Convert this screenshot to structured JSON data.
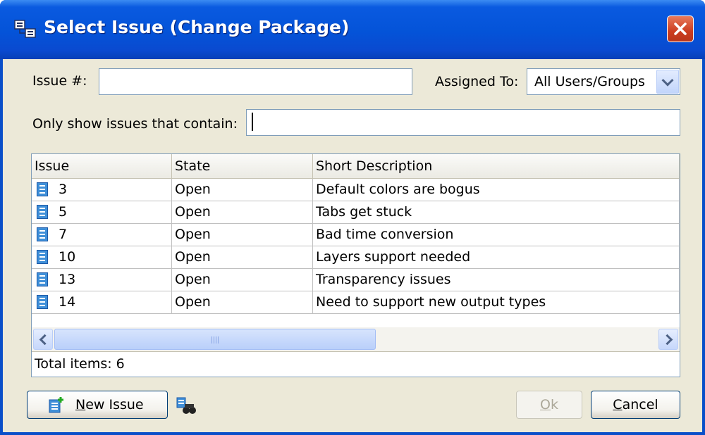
{
  "window": {
    "title": "Select Issue (Change Package)"
  },
  "form": {
    "issue_label": "Issue #:",
    "issue_value": "",
    "assigned_label": "Assigned To:",
    "assigned_value": "All Users/Groups",
    "filter_label": "Only show issues that contain:",
    "filter_value": ""
  },
  "table": {
    "columns": [
      "Issue",
      "State",
      "Short Description"
    ],
    "rows": [
      {
        "issue": "3",
        "state": "Open",
        "description": "Default colors are bogus"
      },
      {
        "issue": "5",
        "state": "Open",
        "description": "Tabs get stuck"
      },
      {
        "issue": "7",
        "state": "Open",
        "description": "Bad time conversion"
      },
      {
        "issue": "10",
        "state": "Open",
        "description": "Layers support needed"
      },
      {
        "issue": "13",
        "state": "Open",
        "description": "Transparency issues"
      },
      {
        "issue": "14",
        "state": "Open",
        "description": "Need to support new output types"
      }
    ],
    "status": "Total items: 6"
  },
  "buttons": {
    "new_issue_mnemonic": "N",
    "new_issue_rest": "ew Issue",
    "ok_mnemonic": "O",
    "ok_rest": "k",
    "cancel_mnemonic": "C",
    "cancel_rest": "ancel"
  },
  "icons": {
    "title": "package-icon",
    "close": "close-icon",
    "issue": "issue-document-icon",
    "new_issue": "new-issue-icon",
    "find": "binoculars-icon"
  },
  "colors": {
    "titlebar": "#0453d8",
    "dialog_bg": "#ece9d8",
    "close_button": "#cc3d20",
    "issue_icon": "#3f8fd8"
  }
}
